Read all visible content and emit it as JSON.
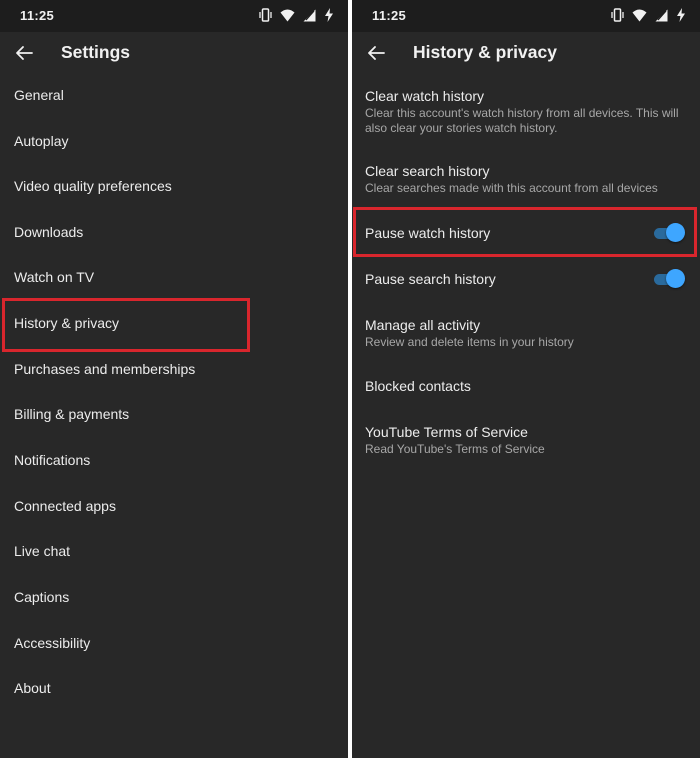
{
  "left": {
    "status_time": "11:25",
    "title": "Settings",
    "items": [
      {
        "label": "General"
      },
      {
        "label": "Autoplay"
      },
      {
        "label": "Video quality preferences"
      },
      {
        "label": "Downloads"
      },
      {
        "label": "Watch on TV"
      },
      {
        "label": "History & privacy"
      },
      {
        "label": "Purchases and memberships"
      },
      {
        "label": "Billing & payments"
      },
      {
        "label": "Notifications"
      },
      {
        "label": "Connected apps"
      },
      {
        "label": "Live chat"
      },
      {
        "label": "Captions"
      },
      {
        "label": "Accessibility"
      },
      {
        "label": "About"
      }
    ]
  },
  "right": {
    "status_time": "11:25",
    "title": "History & privacy",
    "options": [
      {
        "title": "Clear watch history",
        "subtitle": "Clear this account's watch history from all devices. This will also clear your stories watch history."
      },
      {
        "title": "Clear search history",
        "subtitle": "Clear searches made with this account from all devices"
      },
      {
        "title": "Pause watch history",
        "toggle_on": true
      },
      {
        "title": "Pause search history",
        "toggle_on": true
      },
      {
        "title": "Manage all activity",
        "subtitle": "Review and delete items in your history"
      },
      {
        "title": "Blocked contacts"
      },
      {
        "title": "YouTube Terms of Service",
        "subtitle": "Read YouTube's Terms of Service"
      }
    ]
  },
  "status_icons": [
    "vibrate-icon",
    "wifi-icon",
    "signal-icon",
    "charging-icon"
  ],
  "colors": {
    "background": "#282828",
    "statusbar": "#1d1d1d",
    "text": "#ececec",
    "subtext": "#a7a7a7",
    "toggle_accent": "#3ea6ff",
    "highlight": "#d9262d"
  }
}
